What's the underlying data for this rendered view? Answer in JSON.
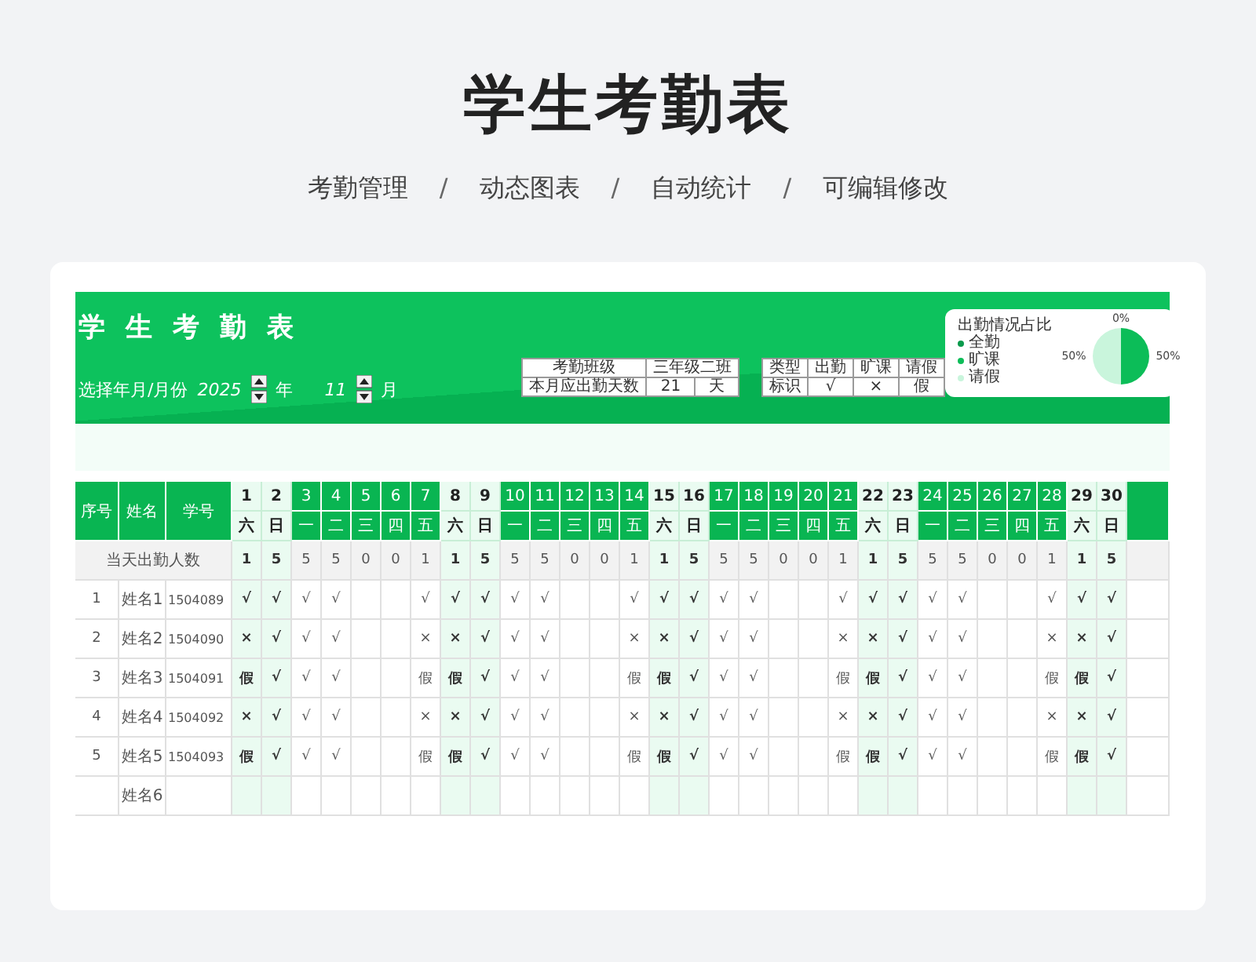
{
  "page_title": "学生考勤表",
  "subtitle": [
    "考勤管理",
    "/",
    "动态图表",
    "/",
    "自动统计",
    "/",
    "可编辑修改"
  ],
  "sheet": {
    "title": "学生考勤表",
    "selector": {
      "label": "选择年月/月份",
      "year": "2025",
      "year_unit": "年",
      "month": "11",
      "month_unit": "月"
    },
    "info": {
      "rows": [
        {
          "cells": [
            {
              "text": "考勤班级"
            },
            {
              "text": "三年级二班",
              "colspan": 2
            }
          ]
        },
        {
          "cells": [
            {
              "text": "本月应出勤天数"
            },
            {
              "text": "21"
            },
            {
              "text": "天"
            }
          ]
        }
      ]
    },
    "legend": {
      "rows": [
        [
          "类型",
          "出勤",
          "旷课",
          "请假"
        ],
        [
          "标识",
          "√",
          "×",
          "假"
        ]
      ]
    },
    "chart": {
      "chart_data": {
        "type": "pie",
        "title": "出勤情况占比",
        "categories": [
          "全勤",
          "旷课",
          "请假"
        ],
        "values": [
          0,
          50,
          50
        ],
        "value_labels": [
          "0%",
          "50%",
          "50%"
        ]
      },
      "slices": [
        {
          "color": "#0a9a4c"
        },
        {
          "color": "#0cbd58"
        },
        {
          "color": "#c9f5dc"
        }
      ]
    },
    "table": {
      "columns": [
        "序号",
        "姓名",
        "学号"
      ],
      "days": [
        {
          "date": "1",
          "weekday": "六",
          "weekend": true
        },
        {
          "date": "2",
          "weekday": "日",
          "weekend": true
        },
        {
          "date": "3",
          "weekday": "一",
          "weekend": false
        },
        {
          "date": "4",
          "weekday": "二",
          "weekend": false
        },
        {
          "date": "5",
          "weekday": "三",
          "weekend": false
        },
        {
          "date": "6",
          "weekday": "四",
          "weekend": false
        },
        {
          "date": "7",
          "weekday": "五",
          "weekend": false
        },
        {
          "date": "8",
          "weekday": "六",
          "weekend": true
        },
        {
          "date": "9",
          "weekday": "日",
          "weekend": true
        },
        {
          "date": "10",
          "weekday": "一",
          "weekend": false
        },
        {
          "date": "11",
          "weekday": "二",
          "weekend": false
        },
        {
          "date": "12",
          "weekday": "三",
          "weekend": false
        },
        {
          "date": "13",
          "weekday": "四",
          "weekend": false
        },
        {
          "date": "14",
          "weekday": "五",
          "weekend": false
        },
        {
          "date": "15",
          "weekday": "六",
          "weekend": true
        },
        {
          "date": "16",
          "weekday": "日",
          "weekend": true
        },
        {
          "date": "17",
          "weekday": "一",
          "weekend": false
        },
        {
          "date": "18",
          "weekday": "二",
          "weekend": false
        },
        {
          "date": "19",
          "weekday": "三",
          "weekend": false
        },
        {
          "date": "20",
          "weekday": "四",
          "weekend": false
        },
        {
          "date": "21",
          "weekday": "五",
          "weekend": false
        },
        {
          "date": "22",
          "weekday": "六",
          "weekend": true
        },
        {
          "date": "23",
          "weekday": "日",
          "weekend": true
        },
        {
          "date": "24",
          "weekday": "一",
          "weekend": false
        },
        {
          "date": "25",
          "weekday": "二",
          "weekend": false
        },
        {
          "date": "26",
          "weekday": "三",
          "weekend": false
        },
        {
          "date": "27",
          "weekday": "四",
          "weekend": false
        },
        {
          "date": "28",
          "weekday": "五",
          "weekend": false
        },
        {
          "date": "29",
          "weekday": "六",
          "weekend": true
        },
        {
          "date": "30",
          "weekday": "日",
          "weekend": true
        }
      ],
      "count_label": "当天出勤人数",
      "counts": [
        "1",
        "5",
        "5",
        "5",
        "0",
        "0",
        "1",
        "1",
        "5",
        "5",
        "5",
        "0",
        "0",
        "1",
        "1",
        "5",
        "5",
        "5",
        "0",
        "0",
        "1",
        "1",
        "5",
        "5",
        "5",
        "0",
        "0",
        "1",
        "1",
        "5"
      ],
      "rows": [
        {
          "seq": "1",
          "name": "姓名1",
          "id": "1504089",
          "marks": {
            "1": "√",
            "2": "√",
            "3": "√",
            "4": "√",
            "7": "√",
            "8": "√",
            "9": "√",
            "10": "√",
            "11": "√",
            "14": "√",
            "15": "√",
            "16": "√",
            "17": "√",
            "18": "√",
            "21": "√",
            "22": "√",
            "23": "√",
            "24": "√",
            "25": "√",
            "28": "√",
            "29": "√",
            "30": "√"
          }
        },
        {
          "seq": "2",
          "name": "姓名2",
          "id": "1504090",
          "marks": {
            "1": "×",
            "2": "√",
            "3": "√",
            "4": "√",
            "7": "×",
            "8": "×",
            "9": "√",
            "10": "√",
            "11": "√",
            "14": "×",
            "15": "×",
            "16": "√",
            "17": "√",
            "18": "√",
            "21": "×",
            "22": "×",
            "23": "√",
            "24": "√",
            "25": "√",
            "28": "×",
            "29": "×",
            "30": "√"
          }
        },
        {
          "seq": "3",
          "name": "姓名3",
          "id": "1504091",
          "marks": {
            "1": "假",
            "2": "√",
            "3": "√",
            "4": "√",
            "7": "假",
            "8": "假",
            "9": "√",
            "10": "√",
            "11": "√",
            "14": "假",
            "15": "假",
            "16": "√",
            "17": "√",
            "18": "√",
            "21": "假",
            "22": "假",
            "23": "√",
            "24": "√",
            "25": "√",
            "28": "假",
            "29": "假",
            "30": "√"
          }
        },
        {
          "seq": "4",
          "name": "姓名4",
          "id": "1504092",
          "marks": {
            "1": "×",
            "2": "√",
            "3": "√",
            "4": "√",
            "7": "×",
            "8": "×",
            "9": "√",
            "10": "√",
            "11": "√",
            "14": "×",
            "15": "×",
            "16": "√",
            "17": "√",
            "18": "√",
            "21": "×",
            "22": "×",
            "23": "√",
            "24": "√",
            "25": "√",
            "28": "×",
            "29": "×",
            "30": "√"
          }
        },
        {
          "seq": "5",
          "name": "姓名5",
          "id": "1504093",
          "marks": {
            "1": "假",
            "2": "√",
            "3": "√",
            "4": "√",
            "7": "假",
            "8": "假",
            "9": "√",
            "10": "√",
            "11": "√",
            "14": "假",
            "15": "假",
            "16": "√",
            "17": "√",
            "18": "√",
            "21": "假",
            "22": "假",
            "23": "√",
            "24": "√",
            "25": "√",
            "28": "假",
            "29": "假",
            "30": "√"
          }
        },
        {
          "name": "姓名6"
        }
      ]
    }
  }
}
